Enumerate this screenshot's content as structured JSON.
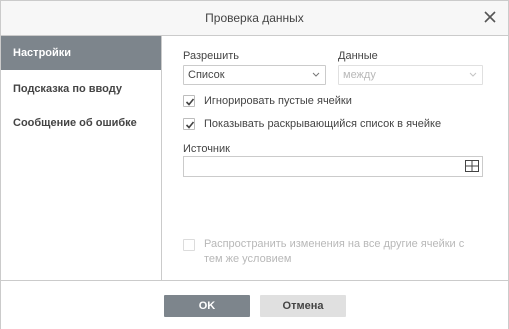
{
  "dialog": {
    "title": "Проверка данных"
  },
  "sidebar": {
    "items": [
      {
        "label": "Настройки",
        "active": true
      },
      {
        "label": "Подсказка по вводу",
        "active": false
      },
      {
        "label": "Сообщение об ошибке",
        "active": false
      }
    ]
  },
  "settings": {
    "allow_label": "Разрешить",
    "allow_value": "Список",
    "data_label": "Данные",
    "data_value": "между",
    "ignore_blank_label": "Игнорировать пустые ячейки",
    "ignore_blank_checked": true,
    "show_dropdown_label": "Показывать раскрывающийся список в ячейке",
    "show_dropdown_checked": true,
    "source_label": "Источник",
    "source_value": "",
    "apply_all_label": "Распространить изменения на все другие ячейки с тем же условием",
    "apply_all_checked": false
  },
  "footer": {
    "ok_label": "OK",
    "cancel_label": "Отмена"
  },
  "colors": {
    "accent": "#7d858c",
    "border": "#cbcbcb",
    "titlebar": "#f7f7f7"
  }
}
